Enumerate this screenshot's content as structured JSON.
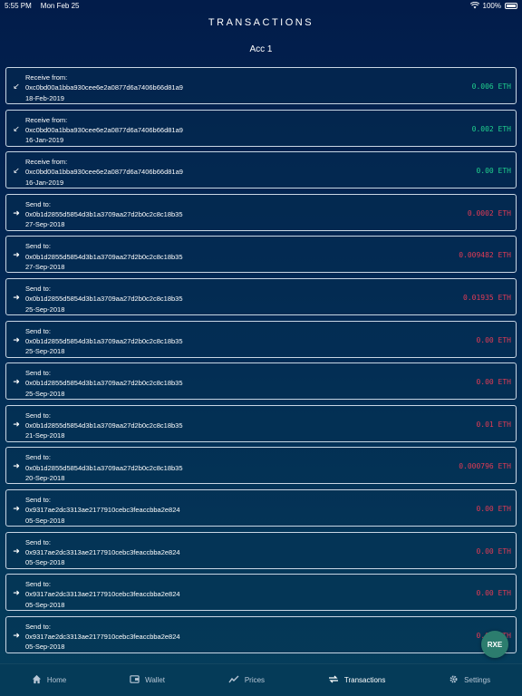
{
  "status_bar": {
    "time": "5:55 PM",
    "date": "Mon Feb 25",
    "battery": "100%",
    "wifi_icon": "wifi-icon",
    "battery_icon": "battery-icon"
  },
  "header": {
    "title": "TRANSACTIONS",
    "account": "Acc 1"
  },
  "colors": {
    "received": "#20d08e",
    "sent": "#e23b55",
    "accent": "#2c7d6e"
  },
  "transactions": [
    {
      "label": "Receive from:",
      "address": "0xc0bd00a1bba930cee6e2a0877d6a7406b66d81a9",
      "date": "18-Feb-2019",
      "amount": "0.006 ETH",
      "direction": "in"
    },
    {
      "label": "Receive from:",
      "address": "0xc0bd00a1bba930cee6e2a0877d6a7406b66d81a9",
      "date": "16-Jan-2019",
      "amount": "0.002 ETH",
      "direction": "in"
    },
    {
      "label": "Receive from:",
      "address": "0xc0bd00a1bba930cee6e2a0877d6a7406b66d81a9",
      "date": "16-Jan-2019",
      "amount": "0.00 ETH",
      "direction": "in"
    },
    {
      "label": "Send to:",
      "address": "0x0b1d2855d5854d3b1a3709aa27d2b0c2c8c18b35",
      "date": "27-Sep-2018",
      "amount": "0.0002 ETH",
      "direction": "out"
    },
    {
      "label": "Send to:",
      "address": "0x0b1d2855d5854d3b1a3709aa27d2b0c2c8c18b35",
      "date": "27-Sep-2018",
      "amount": "0.009482 ETH",
      "direction": "out"
    },
    {
      "label": "Send to:",
      "address": "0x0b1d2855d5854d3b1a3709aa27d2b0c2c8c18b35",
      "date": "25-Sep-2018",
      "amount": "0.01935 ETH",
      "direction": "out"
    },
    {
      "label": "Send to:",
      "address": "0x0b1d2855d5854d3b1a3709aa27d2b0c2c8c18b35",
      "date": "25-Sep-2018",
      "amount": "0.00 ETH",
      "direction": "out"
    },
    {
      "label": "Send to:",
      "address": "0x0b1d2855d5854d3b1a3709aa27d2b0c2c8c18b35",
      "date": "25-Sep-2018",
      "amount": "0.00 ETH",
      "direction": "out"
    },
    {
      "label": "Send to:",
      "address": "0x0b1d2855d5854d3b1a3709aa27d2b0c2c8c18b35",
      "date": "21-Sep-2018",
      "amount": "0.01 ETH",
      "direction": "out"
    },
    {
      "label": "Send to:",
      "address": "0x0b1d2855d5854d3b1a3709aa27d2b0c2c8c18b35",
      "date": "20-Sep-2018",
      "amount": "0.000796 ETH",
      "direction": "out"
    },
    {
      "label": "Send to:",
      "address": "0x9317ae2dc3313ae2177910cebc3feaccbba2e824",
      "date": "05-Sep-2018",
      "amount": "0.00 ETH",
      "direction": "out"
    },
    {
      "label": "Send to:",
      "address": "0x9317ae2dc3313ae2177910cebc3feaccbba2e824",
      "date": "05-Sep-2018",
      "amount": "0.00 ETH",
      "direction": "out"
    },
    {
      "label": "Send to:",
      "address": "0x9317ae2dc3313ae2177910cebc3feaccbba2e824",
      "date": "05-Sep-2018",
      "amount": "0.00 ETH",
      "direction": "out"
    },
    {
      "label": "Send to:",
      "address": "0x9317ae2dc3313ae2177910cebc3feaccbba2e824",
      "date": "05-Sep-2018",
      "amount": "0.00 ETH",
      "direction": "out"
    }
  ],
  "fab": {
    "label": "RXE"
  },
  "tabs": [
    {
      "label": "Home",
      "icon": "home-icon",
      "active": false
    },
    {
      "label": "Wallet",
      "icon": "wallet-icon",
      "active": false
    },
    {
      "label": "Prices",
      "icon": "chart-line-icon",
      "active": false
    },
    {
      "label": "Transactions",
      "icon": "transfer-icon",
      "active": true
    },
    {
      "label": "Settings",
      "icon": "gear-icon",
      "active": false
    }
  ]
}
